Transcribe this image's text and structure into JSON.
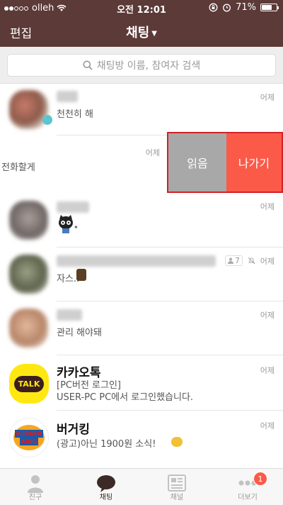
{
  "status_bar": {
    "carrier": "olleh",
    "time": "오전 12:01",
    "battery": "71%",
    "battery_level": 0.71
  },
  "nav": {
    "edit_label": "편집",
    "title": "채팅"
  },
  "search": {
    "placeholder": "채팅방 이름, 참여자 검색"
  },
  "chats": [
    {
      "name": "",
      "message": "천천히 해",
      "time": "어제"
    },
    {
      "name": "",
      "message": "전화할게",
      "time": "어제"
    },
    {
      "name": "",
      "message": "",
      "time": "어제"
    },
    {
      "name": "",
      "message": "자스..",
      "time": "어제",
      "member_count": "7"
    },
    {
      "name": "",
      "message": "관리 해야돼",
      "time": "어제"
    },
    {
      "name": "카카오톡",
      "message": "[PC버전 로그인]",
      "message2": "USER-PC PC에서 로그인했습니다.",
      "time": "어제",
      "logo_text": "TALK"
    },
    {
      "name": "버거킹",
      "message": "(광고)아닌 1900원 소식!",
      "time": "어제",
      "logo_text1": "BURGER",
      "logo_text2": "KING"
    }
  ],
  "swipe_actions": {
    "read_label": "읽음",
    "leave_label": "나가기"
  },
  "tabs": [
    {
      "label": "친구",
      "icon": "person-icon"
    },
    {
      "label": "채팅",
      "icon": "chat-bubble-icon"
    },
    {
      "label": "채널",
      "icon": "channel-icon"
    },
    {
      "label": "더보기",
      "icon": "more-icon",
      "badge": "1"
    }
  ],
  "colors": {
    "header": "#5b3a37",
    "leave": "#fc5a48",
    "read": "#a8a8a8",
    "kakao_yellow": "#ffe812"
  }
}
